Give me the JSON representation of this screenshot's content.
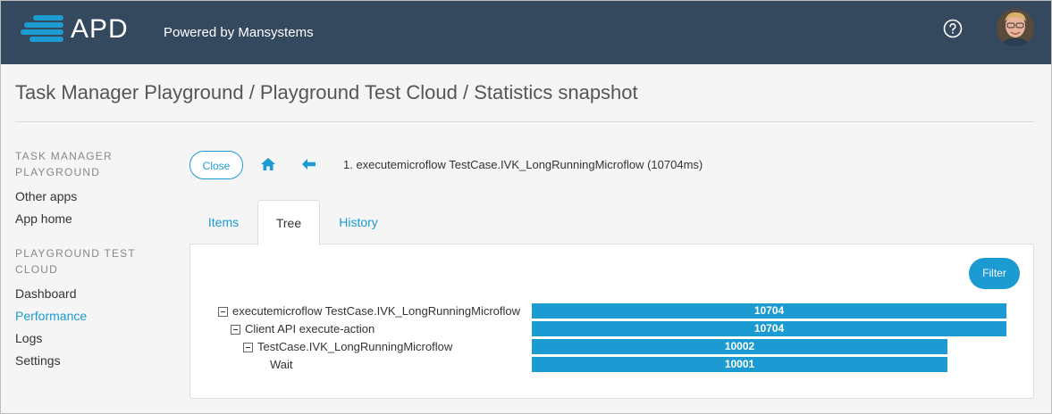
{
  "header": {
    "logo_text": "APD",
    "powered_by": "Powered by Mansystems",
    "help_icon": "question-circle-icon",
    "avatar_icon": "user-avatar"
  },
  "page": {
    "title": "Task Manager Playground / Playground Test Cloud / Statistics snapshot"
  },
  "sidebar": {
    "sections": [
      {
        "heading": "TASK MANAGER PLAYGROUND",
        "items": [
          {
            "label": "Other apps",
            "active": false
          },
          {
            "label": "App home",
            "active": false
          }
        ]
      },
      {
        "heading": "PLAYGROUND TEST CLOUD",
        "items": [
          {
            "label": "Dashboard",
            "active": false
          },
          {
            "label": "Performance",
            "active": true
          },
          {
            "label": "Logs",
            "active": false
          },
          {
            "label": "Settings",
            "active": false
          }
        ]
      }
    ]
  },
  "toolbar": {
    "close_label": "Close",
    "home_icon": "home-icon",
    "back_icon": "arrow-left-icon",
    "breadcrumb": "1. executemicroflow TestCase.IVK_LongRunningMicroflow (10704ms)"
  },
  "tabs": [
    {
      "label": "Items",
      "active": false
    },
    {
      "label": "Tree",
      "active": true
    },
    {
      "label": "History",
      "active": false
    }
  ],
  "tree": {
    "filter_label": "Filter",
    "max_value": 10704,
    "rows": [
      {
        "label": "executemicroflow TestCase.IVK_LongRunningMicroflow",
        "value": "10704",
        "depth": 0,
        "expandable": true
      },
      {
        "label": "Client API execute-action",
        "value": "10704",
        "depth": 1,
        "expandable": true
      },
      {
        "label": "TestCase.IVK_LongRunningMicroflow",
        "value": "10002",
        "depth": 2,
        "expandable": true
      },
      {
        "label": "Wait",
        "value": "10001",
        "depth": 3,
        "expandable": false
      }
    ]
  },
  "colors": {
    "header_bg": "#34495e",
    "accent": "#1b9bd1"
  }
}
